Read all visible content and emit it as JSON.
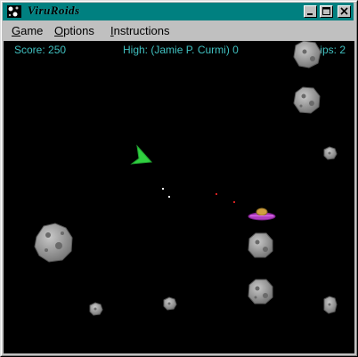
{
  "window": {
    "title": "ViruRoids"
  },
  "menu": {
    "items": [
      {
        "label": "Game",
        "mnemonic": "G"
      },
      {
        "label": "Options",
        "mnemonic": "O"
      },
      {
        "label": "Instructions",
        "mnemonic": "I"
      }
    ]
  },
  "hud": {
    "score_label": "Score:",
    "score_value": "250",
    "high_label": "High:",
    "high_holder": "Jamie P. Curmi",
    "high_value": "0",
    "ships_label": "Ships:",
    "ships_value": "2"
  },
  "colors": {
    "hud_text": "#40c0c0",
    "ship": "#30d040",
    "asteroid": "#9a9a9a",
    "ufo_body": "#b040c0",
    "ufo_dome": "#d0a040",
    "titlebar": "#008080"
  },
  "icons": {
    "app": "viruroids-app-icon",
    "minimize": "minimize-icon",
    "maximize": "maximize-icon",
    "close": "close-icon"
  }
}
